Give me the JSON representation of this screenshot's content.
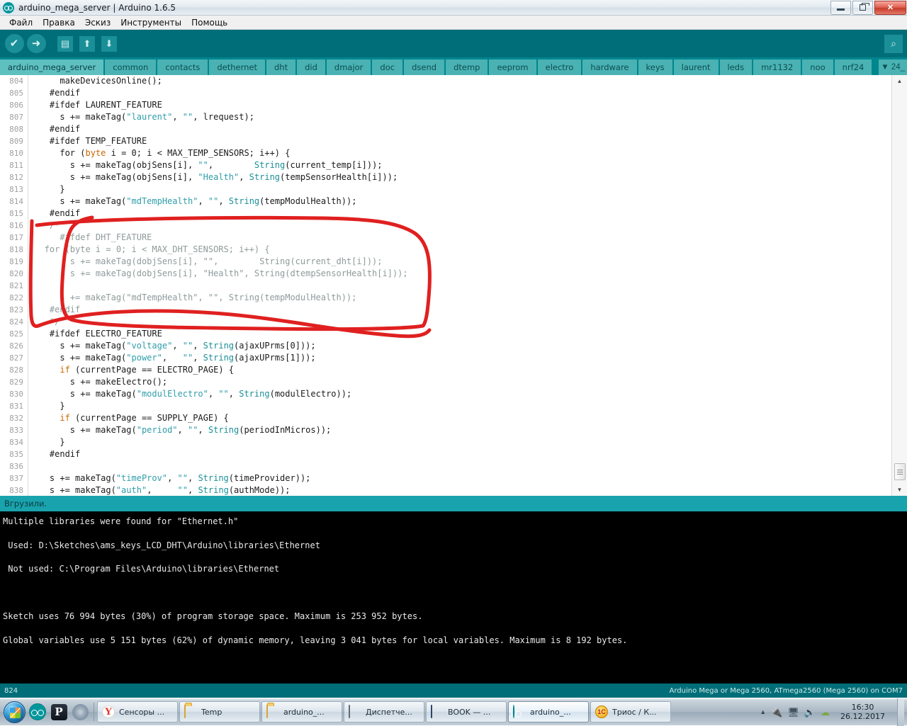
{
  "window": {
    "title": "arduino_mega_server | Arduino 1.6.5",
    "icon": "arduino-logo-icon",
    "minimize_label": "–",
    "restore_label": "❐",
    "close_label": "✕"
  },
  "menubar": {
    "items": [
      {
        "label": "Файл"
      },
      {
        "label": "Правка"
      },
      {
        "label": "Эскиз"
      },
      {
        "label": "Инструменты"
      },
      {
        "label": "Помощь"
      }
    ]
  },
  "toolbar": {
    "buttons": [
      {
        "name": "verify-button",
        "icon": "checkmark-icon",
        "glyph": "✔"
      },
      {
        "name": "upload-button",
        "icon": "right-arrow-icon",
        "glyph": "➜"
      },
      {
        "name": "new-button",
        "icon": "new-file-icon",
        "glyph": "▤"
      },
      {
        "name": "open-button",
        "icon": "up-arrow-icon",
        "glyph": "⬆"
      },
      {
        "name": "save-button",
        "icon": "down-arrow-icon",
        "glyph": "⬇"
      }
    ],
    "serial_monitor": {
      "name": "serial-monitor-button",
      "icon": "magnifier-icon",
      "glyph": "⌕"
    }
  },
  "tabs": {
    "items": [
      {
        "label": "arduino_mega_server",
        "active": true
      },
      {
        "label": "common",
        "active": false
      },
      {
        "label": "contacts",
        "active": false
      },
      {
        "label": "dethernet",
        "active": false
      },
      {
        "label": "dht",
        "active": false
      },
      {
        "label": "did",
        "active": false
      },
      {
        "label": "dmajor",
        "active": false
      },
      {
        "label": "doc",
        "active": false
      },
      {
        "label": "dsend",
        "active": false
      },
      {
        "label": "dtemp",
        "active": false
      },
      {
        "label": "eeprom",
        "active": false
      },
      {
        "label": "electro",
        "active": false
      },
      {
        "label": "hardware",
        "active": false
      },
      {
        "label": "keys",
        "active": false
      },
      {
        "label": "laurent",
        "active": false
      },
      {
        "label": "leds",
        "active": false
      },
      {
        "label": "mr1132",
        "active": false
      },
      {
        "label": "noo",
        "active": false
      },
      {
        "label": "nrf24",
        "active": false
      }
    ],
    "more_label": "▼ 24_"
  },
  "editor": {
    "first_line": 804,
    "lines": [
      {
        "n": 804,
        "segments": [
          {
            "t": "      makeDevicesOnline();",
            "c": "pre"
          }
        ]
      },
      {
        "n": 805,
        "segments": [
          {
            "t": "    #endif",
            "c": "pre"
          }
        ]
      },
      {
        "n": 806,
        "segments": [
          {
            "t": "    #ifdef LAURENT_FEATURE",
            "c": "pre"
          }
        ]
      },
      {
        "n": 807,
        "segments": [
          {
            "t": "      s += makeTag(",
            "c": "pre"
          },
          {
            "t": "\"laurent\"",
            "c": "str"
          },
          {
            "t": ", ",
            "c": "pre"
          },
          {
            "t": "\"\"",
            "c": "str"
          },
          {
            "t": ", lrequest);",
            "c": "pre"
          }
        ]
      },
      {
        "n": 808,
        "segments": [
          {
            "t": "    #endif",
            "c": "pre"
          }
        ]
      },
      {
        "n": 809,
        "segments": [
          {
            "t": "    #ifdef TEMP_FEATURE",
            "c": "pre"
          }
        ]
      },
      {
        "n": 810,
        "segments": [
          {
            "t": "      for (",
            "c": "pre"
          },
          {
            "t": "byte",
            "c": "kw"
          },
          {
            "t": " i = 0; i < MAX_TEMP_SENSORS; i++) {",
            "c": "pre"
          }
        ]
      },
      {
        "n": 811,
        "segments": [
          {
            "t": "        s += makeTag(objSens[i], ",
            "c": "pre"
          },
          {
            "t": "\"\"",
            "c": "str"
          },
          {
            "t": ",        ",
            "c": "pre"
          },
          {
            "t": "String",
            "c": "typ"
          },
          {
            "t": "(current_temp[i]));",
            "c": "pre"
          }
        ]
      },
      {
        "n": 812,
        "segments": [
          {
            "t": "        s += makeTag(objSens[i], ",
            "c": "pre"
          },
          {
            "t": "\"Health\"",
            "c": "str"
          },
          {
            "t": ", ",
            "c": "pre"
          },
          {
            "t": "String",
            "c": "typ"
          },
          {
            "t": "(tempSensorHealth[i]));",
            "c": "pre"
          }
        ]
      },
      {
        "n": 813,
        "segments": [
          {
            "t": "      }",
            "c": "pre"
          }
        ]
      },
      {
        "n": 814,
        "segments": [
          {
            "t": "      s += makeTag(",
            "c": "pre"
          },
          {
            "t": "\"mdTempHealth\"",
            "c": "str"
          },
          {
            "t": ", ",
            "c": "pre"
          },
          {
            "t": "\"\"",
            "c": "str"
          },
          {
            "t": ", ",
            "c": "pre"
          },
          {
            "t": "String",
            "c": "typ"
          },
          {
            "t": "(tempModulHealth));",
            "c": "pre"
          }
        ]
      },
      {
        "n": 815,
        "segments": [
          {
            "t": "    #endif",
            "c": "pre"
          }
        ]
      },
      {
        "n": 816,
        "segments": [
          {
            "t": "    /*",
            "c": "cmt"
          }
        ]
      },
      {
        "n": 817,
        "segments": [
          {
            "t": "      #ifdef DHT_FEATURE",
            "c": "cmt"
          }
        ]
      },
      {
        "n": 818,
        "segments": [
          {
            "t": "   for (byte i = 0; i < MAX_DHT_SENSORS; i++) {",
            "c": "cmt"
          }
        ]
      },
      {
        "n": 819,
        "segments": [
          {
            "t": "        s += makeTag(dobjSens[i], \"\",        String(current_dht[i]));",
            "c": "cmt"
          }
        ]
      },
      {
        "n": 820,
        "segments": [
          {
            "t": "        s += makeTag(dobjSens[i], \"Health\", String(dtempSensorHealth[i]));",
            "c": "cmt"
          }
        ]
      },
      {
        "n": 821,
        "segments": [
          {
            "t": "      }",
            "c": "cmt"
          }
        ]
      },
      {
        "n": 822,
        "segments": [
          {
            "t": "      s += makeTag(\"mdTempHealth\", \"\", String(tempModulHealth));",
            "c": "cmt"
          }
        ]
      },
      {
        "n": 823,
        "segments": [
          {
            "t": "    #endif",
            "c": "cmt"
          }
        ]
      },
      {
        "n": 824,
        "segments": [
          {
            "t": "    */",
            "c": "cmt"
          }
        ]
      },
      {
        "n": 825,
        "segments": [
          {
            "t": "    #ifdef ELECTRO_FEATURE",
            "c": "pre"
          }
        ]
      },
      {
        "n": 826,
        "segments": [
          {
            "t": "      s += makeTag(",
            "c": "pre"
          },
          {
            "t": "\"voltage\"",
            "c": "str"
          },
          {
            "t": ", ",
            "c": "pre"
          },
          {
            "t": "\"\"",
            "c": "str"
          },
          {
            "t": ", ",
            "c": "pre"
          },
          {
            "t": "String",
            "c": "typ"
          },
          {
            "t": "(ajaxUPrms[0]));",
            "c": "pre"
          }
        ]
      },
      {
        "n": 827,
        "segments": [
          {
            "t": "      s += makeTag(",
            "c": "pre"
          },
          {
            "t": "\"power\"",
            "c": "str"
          },
          {
            "t": ",   ",
            "c": "pre"
          },
          {
            "t": "\"\"",
            "c": "str"
          },
          {
            "t": ", ",
            "c": "pre"
          },
          {
            "t": "String",
            "c": "typ"
          },
          {
            "t": "(ajaxUPrms[1]));",
            "c": "pre"
          }
        ]
      },
      {
        "n": 828,
        "segments": [
          {
            "t": "      ",
            "c": "pre"
          },
          {
            "t": "if",
            "c": "kw"
          },
          {
            "t": " (currentPage == ELECTRO_PAGE) {",
            "c": "pre"
          }
        ]
      },
      {
        "n": 829,
        "segments": [
          {
            "t": "        s += makeElectro();",
            "c": "pre"
          }
        ]
      },
      {
        "n": 830,
        "segments": [
          {
            "t": "        s += makeTag(",
            "c": "pre"
          },
          {
            "t": "\"modulElectro\"",
            "c": "str"
          },
          {
            "t": ", ",
            "c": "pre"
          },
          {
            "t": "\"\"",
            "c": "str"
          },
          {
            "t": ", ",
            "c": "pre"
          },
          {
            "t": "String",
            "c": "typ"
          },
          {
            "t": "(modulElectro));",
            "c": "pre"
          }
        ]
      },
      {
        "n": 831,
        "segments": [
          {
            "t": "      }",
            "c": "pre"
          }
        ]
      },
      {
        "n": 832,
        "segments": [
          {
            "t": "      ",
            "c": "pre"
          },
          {
            "t": "if",
            "c": "kw"
          },
          {
            "t": " (currentPage == SUPPLY_PAGE) {",
            "c": "pre"
          }
        ]
      },
      {
        "n": 833,
        "segments": [
          {
            "t": "        s += makeTag(",
            "c": "pre"
          },
          {
            "t": "\"period\"",
            "c": "str"
          },
          {
            "t": ", ",
            "c": "pre"
          },
          {
            "t": "\"\"",
            "c": "str"
          },
          {
            "t": ", ",
            "c": "pre"
          },
          {
            "t": "String",
            "c": "typ"
          },
          {
            "t": "(periodInMicros));",
            "c": "pre"
          }
        ]
      },
      {
        "n": 834,
        "segments": [
          {
            "t": "      }",
            "c": "pre"
          }
        ]
      },
      {
        "n": 835,
        "segments": [
          {
            "t": "    #endif",
            "c": "pre"
          }
        ]
      },
      {
        "n": 836,
        "segments": [
          {
            "t": "",
            "c": "pre"
          }
        ]
      },
      {
        "n": 837,
        "segments": [
          {
            "t": "    s += makeTag(",
            "c": "pre"
          },
          {
            "t": "\"timeProv\"",
            "c": "str"
          },
          {
            "t": ", ",
            "c": "pre"
          },
          {
            "t": "\"\"",
            "c": "str"
          },
          {
            "t": ", ",
            "c": "pre"
          },
          {
            "t": "String",
            "c": "typ"
          },
          {
            "t": "(timeProvider));",
            "c": "pre"
          }
        ]
      },
      {
        "n": 838,
        "segments": [
          {
            "t": "    s += makeTag(",
            "c": "pre"
          },
          {
            "t": "\"auth\"",
            "c": "str"
          },
          {
            "t": ",     ",
            "c": "pre"
          },
          {
            "t": "\"\"",
            "c": "str"
          },
          {
            "t": ", ",
            "c": "pre"
          },
          {
            "t": "String",
            "c": "typ"
          },
          {
            "t": "(authMode));",
            "c": "pre"
          }
        ]
      }
    ],
    "annotation_color": "#e02020"
  },
  "status_message": {
    "text": "Вгрузили."
  },
  "console": {
    "lines": [
      "Multiple libraries were found for \"Ethernet.h\"",
      "",
      " Used: D:\\Sketches\\ams_keys_LCD_DHT\\Arduino\\libraries\\Ethernet",
      "",
      " Not used: C:\\Program Files\\Arduino\\libraries\\Ethernet",
      "",
      "",
      "",
      "Sketch uses 76 994 bytes (30%) of program storage space. Maximum is 253 952 bytes.",
      "",
      "Global variables use 5 151 bytes (62%) of dynamic memory, leaving 3 041 bytes for local variables. Maximum is 8 192 bytes."
    ]
  },
  "bottom_bar": {
    "line_number": "824",
    "board_info": "Arduino Mega or Mega 2560, ATmega2560 (Mega 2560) on COM7"
  },
  "taskbar": {
    "start_label": "start-orb",
    "quick_launch": [
      {
        "name": "quick-launch-arduino",
        "icon": "arduino-logo-icon"
      },
      {
        "name": "quick-launch-photoshop",
        "icon": "letter-p-icon",
        "glyph": "P"
      },
      {
        "name": "quick-launch-flower",
        "icon": "flower-icon"
      }
    ],
    "buttons": [
      {
        "label": "Сенсоры ...",
        "icon": "yandex-browser-icon",
        "active": false
      },
      {
        "label": "Temp",
        "icon": "folder-icon",
        "active": false
      },
      {
        "label": "arduino_...",
        "icon": "folder-icon",
        "active": false
      },
      {
        "label": "Диспетче...",
        "icon": "task-manager-icon",
        "active": false
      },
      {
        "label": "BOOK — ...",
        "icon": "remote-desktop-icon",
        "active": false
      },
      {
        "label": "arduino_...",
        "icon": "arduino-logo-icon",
        "active": true
      },
      {
        "label": "Триос / К...",
        "icon": "one-c-icon",
        "active": false
      }
    ],
    "tray": {
      "expand_glyph": "▲",
      "icons": [
        {
          "name": "safely-remove-icon",
          "glyph": "🔌"
        },
        {
          "name": "network-icon",
          "glyph": "🖧"
        },
        {
          "name": "volume-icon",
          "glyph": "🔊"
        },
        {
          "name": "antivirus-icon",
          "glyph": "☁"
        }
      ],
      "time": "16:30",
      "date": "26.12.2017"
    }
  }
}
